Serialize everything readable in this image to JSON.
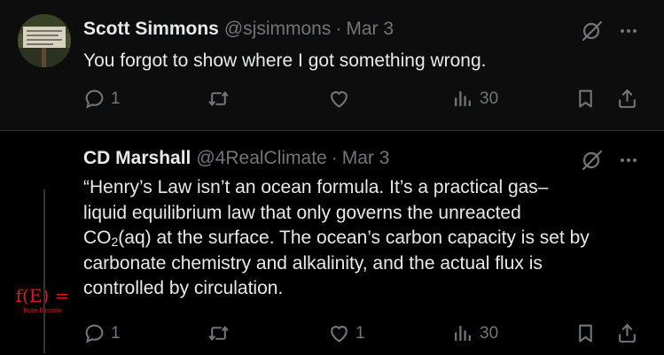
{
  "tweets": [
    {
      "name": "Scott Simmons",
      "handle": "@sjsimmons",
      "date": "Mar 3",
      "text_lines": [
        "You forgot to show where I got something wrong."
      ],
      "replies": "1",
      "retweets": "",
      "likes": "",
      "views": "30"
    },
    {
      "name": "CD Marshall",
      "handle": "@4RealClimate",
      "date": "Mar 3",
      "text_lines": [
        "“Henry’s Law isn’t an ocean formula. It’s a practical gas–",
        "liquid equilibrium law that only governs the unreacted",
        "CO",
        "2",
        "(aq) at the surface. The ocean’s carbon capacity is set by",
        "carbonate chemistry and alkalinity, and the actual flux is",
        "controlled by circulation."
      ],
      "avatar_text": "f(E) =",
      "avatar_subtext": "Bose-Einstein",
      "replies": "1",
      "retweets": "",
      "likes": "1",
      "views": "30"
    }
  ],
  "separator": "·",
  "colors": {
    "background": "#000000",
    "text": "#e7e9ea",
    "muted": "#71767b",
    "border": "#2f3336",
    "avatar_red": "#e0141e"
  },
  "icons": [
    "grok-icon",
    "more-icon",
    "reply-icon",
    "retweet-icon",
    "like-icon",
    "views-icon",
    "bookmark-icon",
    "share-icon"
  ]
}
